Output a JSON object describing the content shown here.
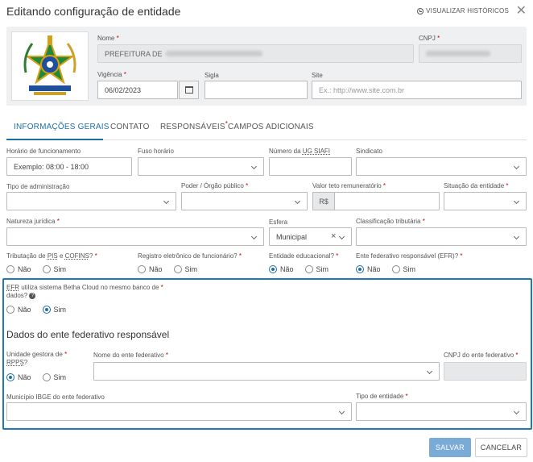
{
  "dialog": {
    "title": "Editando configuração de entidade",
    "history_link": "VISUALIZAR HISTÓRICOS",
    "close_glyph": "✕"
  },
  "header": {
    "nome": {
      "label": "Nome",
      "value": "PREFEITURA DE"
    },
    "cnpj": {
      "label": "CNPJ",
      "value": ""
    },
    "vigencia": {
      "label": "Vigência",
      "value": "06/02/2023"
    },
    "sigla": {
      "label": "Sigla",
      "value": ""
    },
    "site": {
      "label": "Site",
      "placeholder": "Ex.: http://www.site.com.br"
    },
    "required_mark": "*"
  },
  "tabs": [
    {
      "label": "INFORMAÇÕES GERAIS",
      "active": true
    },
    {
      "label": "CONTATO"
    },
    {
      "label": "RESPONSÁVEIS",
      "marker": "*"
    },
    {
      "label": "CAMPOS ADICIONAIS"
    }
  ],
  "fields": {
    "horario": {
      "label": "Horário de funcionamento",
      "placeholder": "Exemplo: 08:00 - 18:00"
    },
    "fuso": {
      "label": "Fuso horário"
    },
    "ug_siafi": {
      "label_prefix": "Número da ",
      "label_abbr": "UG SIAFI"
    },
    "sindicato": {
      "label": "Sindicato"
    },
    "tipo_admin": {
      "label": "Tipo de administração"
    },
    "poder": {
      "label": "Poder / Órgão público"
    },
    "teto": {
      "label": "Valor teto remuneratório",
      "prefix": "R$"
    },
    "situacao": {
      "label": "Situação da entidade"
    },
    "natureza": {
      "label": "Natureza jurídica"
    },
    "esfera": {
      "label": "Esfera",
      "value": "Municipal",
      "clear": "×"
    },
    "classificacao": {
      "label": "Classificação tributária"
    },
    "tributacao": {
      "label_a": "Tributação de ",
      "abbr1": "PIS",
      "label_b": " e ",
      "abbr2": "COFINS",
      "label_c": "?"
    },
    "registro": {
      "label": "Registro eletrônico de funcionário?"
    },
    "educacional": {
      "label": "Entidade educacional?"
    },
    "efr": {
      "label": "Ente federativo responsável (EFR)?"
    }
  },
  "radio": {
    "no": "Não",
    "yes": "Sim"
  },
  "efr_section": {
    "question_abbr": "EFR",
    "question_rest": " utiliza sistema Betha Cloud no mesmo banco de",
    "question_line2": "dados?",
    "help_glyph": "?",
    "title": "Dados do ente federativo responsável",
    "unidade_line1": "Unidade gestora de",
    "unidade_abbr": "RPPS",
    "unidade_q": "?",
    "nome_ente": "Nome do ente federativo",
    "cnpj_ente": "CNPJ do ente federativo",
    "municipio": "Município IBGE do ente federativo",
    "tipo_entidade": "Tipo de entidade"
  },
  "actions": {
    "save": "SALVAR",
    "cancel": "CANCELAR"
  },
  "colors": {
    "accent": "#1d6fa5",
    "required": "#cc0000",
    "save_bg": "#7aaad6",
    "panel_bg": "#eef0f1"
  },
  "icons": [
    "clock-icon",
    "close-icon",
    "coat-of-arms-logo",
    "calendar-icon",
    "chevron-down-icon",
    "help-icon"
  ]
}
